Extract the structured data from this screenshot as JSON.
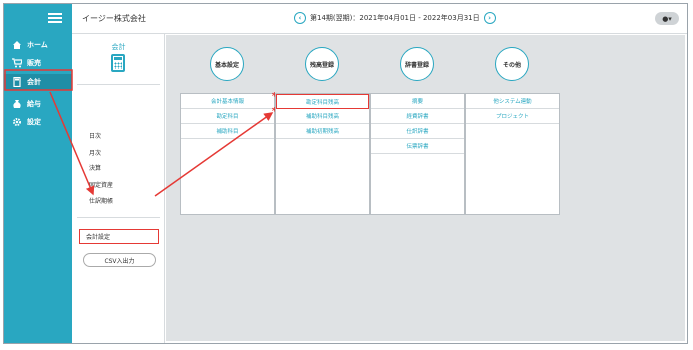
{
  "header": {
    "company_name": "イージー株式会社",
    "fiscal_period": "第14期(翌期)：2021年04月01日 - 2022年03月31日",
    "prev_icon": "chevron-left-icon",
    "next_icon": "chevron-right-icon",
    "user_icon": "user-icon"
  },
  "sidebar": {
    "items": [
      {
        "label": "ホーム",
        "icon": "home-icon"
      },
      {
        "label": "販売",
        "icon": "cart-icon"
      },
      {
        "label": "会計",
        "icon": "calculator-icon"
      },
      {
        "label": "給与",
        "icon": "money-bag-icon"
      },
      {
        "label": "設定",
        "icon": "gear-icon"
      }
    ]
  },
  "subpanel": {
    "title": "会計",
    "items": [
      "日次",
      "月次",
      "決算",
      "固定資産",
      "仕訳期帳"
    ],
    "settings_label": "会計設定",
    "csv_button": "CSV入出力"
  },
  "columns": [
    {
      "title": "基本設定",
      "items": [
        {
          "label": "会計基本情報",
          "required": true
        },
        {
          "label": "勘定科目",
          "required": true
        },
        {
          "label": "補助科目",
          "required": false
        }
      ]
    },
    {
      "title": "残高登録",
      "items": [
        {
          "label": "勘定科目残高",
          "required": false
        },
        {
          "label": "補助科目残高",
          "required": false
        },
        {
          "label": "補助初期残高",
          "required": false
        }
      ]
    },
    {
      "title": "辞書登録",
      "items": [
        {
          "label": "摘要",
          "required": false
        },
        {
          "label": "経費辞書",
          "required": false
        },
        {
          "label": "仕訳辞書",
          "required": false
        },
        {
          "label": "伝票辞書",
          "required": false
        }
      ]
    },
    {
      "title": "その他",
      "items": [
        {
          "label": "他システム連動",
          "required": false
        },
        {
          "label": "プロジェクト",
          "required": false
        }
      ]
    }
  ],
  "colors": {
    "accent": "#29a7c1",
    "highlight": "#e53935",
    "background": "#dfe2e4"
  }
}
